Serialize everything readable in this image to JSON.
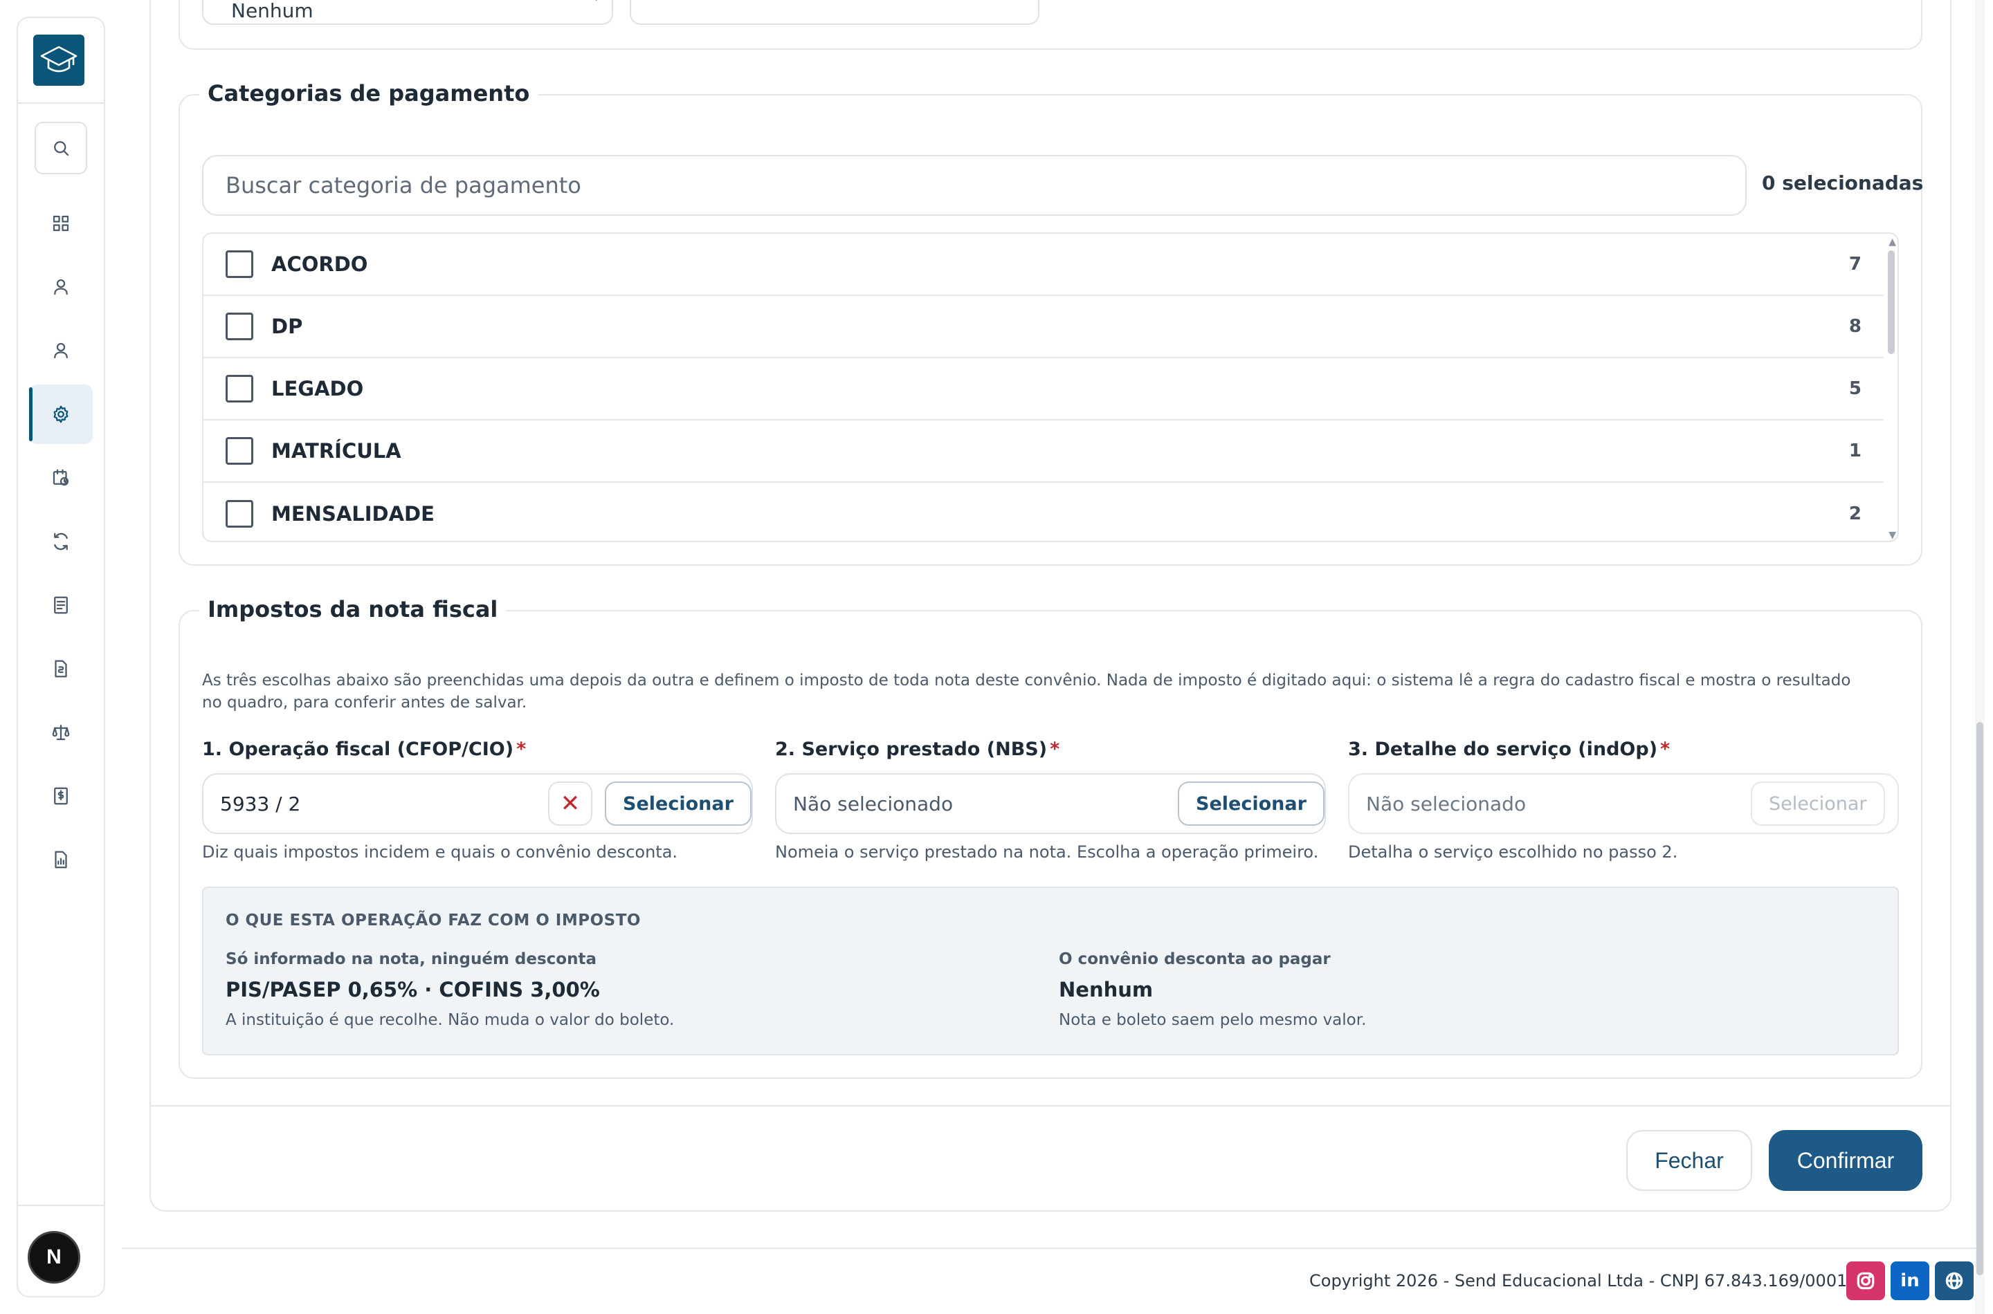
{
  "sidebar": {
    "items": [
      {
        "name": "search-icon",
        "active": false
      },
      {
        "name": "dashboard-icon",
        "active": false
      },
      {
        "name": "user-icon",
        "active": false
      },
      {
        "name": "user-icon",
        "active": false
      },
      {
        "name": "gear-icon",
        "active": true
      },
      {
        "name": "calendar-clock-icon",
        "active": false
      },
      {
        "name": "refresh-icon",
        "active": false
      },
      {
        "name": "document-icon",
        "active": false
      },
      {
        "name": "file-money-icon",
        "active": false
      },
      {
        "name": "scale-icon",
        "active": false
      },
      {
        "name": "money-document-icon",
        "active": false
      },
      {
        "name": "report-icon",
        "active": false
      }
    ],
    "avatar_letter": "N"
  },
  "top": {
    "select_value": "Nenhum"
  },
  "payment_categories": {
    "legend": "Categorias de pagamento",
    "search_placeholder": "Buscar categoria de pagamento",
    "selected_count": "0 selecionadas",
    "items": [
      {
        "label": "ACORDO",
        "count": "7"
      },
      {
        "label": "DP",
        "count": "8"
      },
      {
        "label": "LEGADO",
        "count": "5"
      },
      {
        "label": "MATRÍCULA",
        "count": "1"
      },
      {
        "label": "MENSALIDADE",
        "count": "2"
      }
    ]
  },
  "taxes": {
    "legend": "Impostos da nota fiscal",
    "description": "As três escolhas abaixo são preenchidas uma depois da outra e definem o imposto de toda nota deste convênio. Nada de imposto é digitado aqui: o sistema lê a regra do cadastro fiscal e mostra o resultado no quadro, para conferir antes de salvar.",
    "fields": [
      {
        "label": "1. Operação fiscal (CFOP/CIO)",
        "value": "5933 / 2",
        "button": "Selecionar",
        "hint": "Diz quais impostos incidem e quais o convênio desconta."
      },
      {
        "label": "2. Serviço prestado (NBS)",
        "value": "Não selecionado",
        "button": "Selecionar",
        "hint": "Nomeia o serviço prestado na nota. Escolha a operação primeiro."
      },
      {
        "label": "3. Detalhe do serviço (indOp)",
        "value": "Não selecionado",
        "button": "Selecionar",
        "hint": "Detalha o serviço escolhido no passo 2."
      }
    ],
    "required_mark": "*",
    "clear_symbol": "✕",
    "info": {
      "title": "O QUE ESTA OPERAÇÃO FAZ COM O IMPOSTO",
      "left_sub": "Só informado na nota, ninguém desconta",
      "left_value": "PIS/PASEP 0,65% · COFINS 3,00%",
      "left_note": "A instituição é que recolhe. Não muda o valor do boleto.",
      "right_sub": "O convênio desconta ao pagar",
      "right_value": "Nenhum",
      "right_note": "Nota e boleto saem pelo mesmo valor."
    }
  },
  "footer": {
    "close_label": "Fechar",
    "confirm_label": "Confirmar",
    "copyright": "Copyright 2026 - Send Educacional Ltda - CNPJ 67.843.169/0001-84",
    "linkedin_text": "in",
    "colors": {
      "instagram": "#d6336c",
      "linkedin": "#0a66c2",
      "globe": "#1e5a87",
      "accent": "#1e5a87"
    }
  }
}
